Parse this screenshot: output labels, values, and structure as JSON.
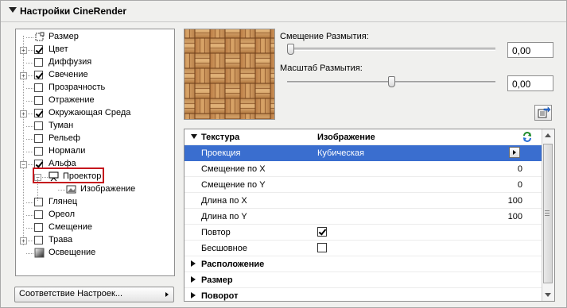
{
  "header": {
    "title": "Настройки CineRender"
  },
  "tree": {
    "items": [
      {
        "label": "Размер",
        "expander": false,
        "checkbox": "special",
        "checked": false
      },
      {
        "label": "Цвет",
        "expander": true,
        "checkbox": "box",
        "checked": true
      },
      {
        "label": "Диффузия",
        "expander": false,
        "checkbox": "box",
        "checked": false
      },
      {
        "label": "Свечение",
        "expander": true,
        "checkbox": "box",
        "checked": true
      },
      {
        "label": "Прозрачность",
        "expander": false,
        "checkbox": "box",
        "checked": false
      },
      {
        "label": "Отражение",
        "expander": false,
        "checkbox": "box",
        "checked": false
      },
      {
        "label": "Окружающая Среда",
        "expander": true,
        "checkbox": "box",
        "checked": true
      },
      {
        "label": "Туман",
        "expander": false,
        "checkbox": "box",
        "checked": false
      },
      {
        "label": "Рельеф",
        "expander": false,
        "checkbox": "box",
        "checked": false
      },
      {
        "label": "Нормали",
        "expander": false,
        "checkbox": "box",
        "checked": false
      },
      {
        "label": "Альфа",
        "expander": "minus",
        "checkbox": "box",
        "checked": true
      },
      {
        "label": "Проектор",
        "expander": "minus",
        "checkbox": "projector-icon",
        "checked": false,
        "level": 1,
        "highlighted": true
      },
      {
        "label": "Изображение",
        "expander": false,
        "checkbox": "image-icon",
        "checked": false,
        "level": 2
      },
      {
        "label": "Глянец",
        "expander": false,
        "checkbox": "box",
        "checked": false
      },
      {
        "label": "Ореол",
        "expander": false,
        "checkbox": "box",
        "checked": false
      },
      {
        "label": "Смещение",
        "expander": false,
        "checkbox": "box",
        "checked": false
      },
      {
        "label": "Трава",
        "expander": true,
        "checkbox": "box",
        "checked": false
      },
      {
        "label": "Освещение",
        "expander": false,
        "checkbox": "gradient-icon",
        "checked": false
      }
    ],
    "bottom_button": "Соответствие Настроек..."
  },
  "sliders": {
    "blur_offset": {
      "label": "Смещение Размытия:",
      "value": "0,00",
      "level": 0.0
    },
    "blur_scale": {
      "label": "Масштаб Размытия:",
      "value": "0,00",
      "level": 0.5
    }
  },
  "properties": {
    "header": {
      "name": "Текстура",
      "value": "Изображение"
    },
    "rows": [
      {
        "name": "Проекция",
        "value": "Кубическая",
        "selected": true,
        "type": "menu"
      },
      {
        "name": "Смещение по X",
        "value": "0",
        "type": "number"
      },
      {
        "name": "Смещение по Y",
        "value": "0",
        "type": "number"
      },
      {
        "name": "Длина по X",
        "value": "100",
        "type": "number"
      },
      {
        "name": "Длина по Y",
        "value": "100",
        "type": "number"
      },
      {
        "name": "Повтор",
        "checked": true,
        "type": "check"
      },
      {
        "name": "Бесшовное",
        "checked": false,
        "type": "check"
      }
    ],
    "groups": [
      "Расположение",
      "Размер",
      "Поворот"
    ]
  },
  "colors": {
    "selection": "#3a6ecf",
    "highlight_border": "#c5161d"
  },
  "icons": [
    "expand-triangle-icon",
    "projector-icon",
    "image-icon",
    "export-icon",
    "refresh-icon",
    "submenu-arrow-icon"
  ]
}
